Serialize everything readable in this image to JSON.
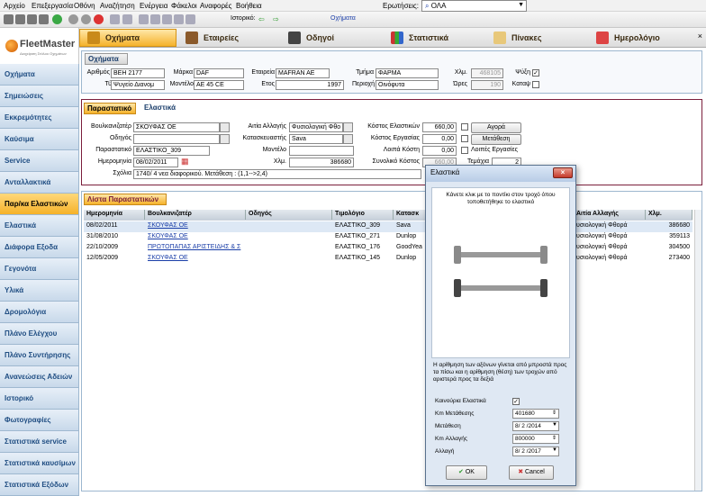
{
  "menu": [
    "Αρχείο",
    "Επεξεργασία",
    "Οθόνη",
    "Αναζήτηση",
    "Ενέργεια",
    "Φάκελοι",
    "Αναφορές",
    "Βοήθεια"
  ],
  "toolbar": {
    "history_label": "Ιστορικό:",
    "history_value": "Οχήματα",
    "query_label": "Ερωτήσεις:",
    "query_value": "ΟΛΑ"
  },
  "logo": {
    "name": "FleetMaster",
    "tagline": "Διαχείριση Στόλου Οχημάτων"
  },
  "nav": [
    {
      "label": "Οχήματα",
      "icon": "truck-icon"
    },
    {
      "label": "Εταιρείες",
      "icon": "people-icon"
    },
    {
      "label": "Οδηγοί",
      "icon": "driver-icon"
    },
    {
      "label": "Στατιστικά",
      "icon": "bar-chart-icon"
    },
    {
      "label": "Πίνακες",
      "icon": "table-icon"
    },
    {
      "label": "Ημερολόγιο",
      "icon": "calendar-icon"
    }
  ],
  "sidebar": [
    "Οχήματα",
    "Σημειώσεις",
    "Εκκρεμότητες",
    "Καύσιμα",
    "Service",
    "Ανταλλακτικά",
    "Παρ/κα Ελαστικών",
    "Ελαστικά",
    "Διάφορα Εξοδα",
    "Γεγονότα",
    "Υλικά",
    "Δρομολόγια",
    "Πλάνο Ελέγχου",
    "Πλάνο Συντήρησης",
    "Ανανεώσεις Αδειών",
    "Ιστορικό",
    "Φωτογραφίες",
    "Στατιστικά service",
    "Στατιστικά καυσίμων",
    "Στατιστικά Εξόδων"
  ],
  "vehicle": {
    "panel_title": "Οχήματα",
    "number_label": "Αριθμός",
    "number": "ΒΕΗ 2177",
    "brand_label": "Μάρκα",
    "brand": "DAF",
    "company_label": "Εταιρεία",
    "company": "MAFRAN AE",
    "dept_label": "Τμήμα",
    "dept": "ΦΑΡΜΑ",
    "km_label": "Χλμ.",
    "km": "468105",
    "freeze_label": "Ψύξη",
    "freeze": "✓",
    "type_label": "Τύπος",
    "type": "Ψυγείο Διανομ",
    "model_label": "Μοντέλο",
    "model": "AE 45 CE",
    "year_label": "Ετος",
    "year": "1997",
    "area_label": "Περιοχή",
    "area": "Οινόφυτα",
    "hours_label": "Ώρες",
    "hours": "190",
    "catal_label": "Καταψ",
    "catal": ""
  },
  "doc_tabs": [
    "Παραστατικό",
    "Ελαστικά"
  ],
  "doc": {
    "vulc_label": "Βουλκανιζατέρ",
    "vulc": "ΣΚΟΥΦΑΣ ΟΕ",
    "driver_label": "Οδηγός",
    "driver": "",
    "paper_label": "Παραστατικό",
    "paper": "ΕΛΑΣΤΙΚΟ_309",
    "date_label": "Ημερομηνία",
    "date": "08/02/2011",
    "notes_label": "Σχόλια",
    "notes": "1740/ 4 νεα διαφορικού.  Μετάθεση : (1,1-->2,4)",
    "reason_label": "Αιτία Αλλαγής",
    "reason": "Φυσιολογική Φθο",
    "maker_label": "Κατασκευαστής",
    "maker": "Sava",
    "model_label": "Μοντέλο",
    "model": "",
    "km_label": "Χλμ.",
    "km": "386680",
    "tire_cost_label": "Κόστος Ελαστικών",
    "tire_cost": "660,00",
    "work_cost_label": "Κόστος Εργασίας",
    "work_cost": "0,00",
    "other_cost_label": "Λοιπά Κόστη",
    "other_cost": "0,00",
    "total_label": "Συνολικό Κόστος",
    "total": "660,00",
    "pieces_label": "Τεμάχια",
    "pieces": "2",
    "buy_label": "Αγορά",
    "move_label": "Μετάθεση",
    "other_work_label": "Λοιπές Εργασίες"
  },
  "list": {
    "title": "Λίστα Παραστατικών",
    "headers": [
      "Ημερομηνία",
      "Βουλκανιζατέρ",
      "Οδηγός",
      "Τιμολόγιο",
      "Κατασκ",
      "",
      "Αιτία Αλλαγής",
      "Χλμ."
    ],
    "rows": [
      [
        "08/02/2011",
        "ΣΚΟΥΦΑΣ ΟΕ",
        "",
        "ΕΛΑΣΤΙΚΟ_309",
        "Sava",
        "υσιολογική Φθορά",
        "386680"
      ],
      [
        "31/08/2010",
        "ΣΚΟΥΦΑΣ ΟΕ",
        "",
        "ΕΛΑΣΤΙΚΟ_271",
        "Dunlop",
        "υσιολογική Φθορά",
        "359113"
      ],
      [
        "22/10/2009",
        "ΠΡΩΤΟΠΑΠΑΣ ΑΡΙΣΤΕΙΔΗΣ & Σ",
        "",
        "ΕΛΑΣΤΙΚΟ_176",
        "GoodYea",
        "υσιολογική Φθορά",
        "304500"
      ],
      [
        "12/05/2009",
        "ΣΚΟΥΦΑΣ ΟΕ",
        "",
        "ΕΛΑΣΤΙΚΟ_145",
        "Dunlop",
        "υσιολογική Φθορά",
        "273400"
      ]
    ]
  },
  "dialog": {
    "title": "Ελαστικά",
    "instruction": "Κάνετε κλικ με το ποντίκι στον τροχό όπου τοποθετήθηκε το ελαστικό",
    "note": "Η αρίθμηση των αξόνων γίνεται από μπροστά προς τα πίσω και η αρίθμηση (θέση) των τροχών από αριστερά προς τα δεξιά",
    "new_tire_label": "Καινούρια Ελαστικά",
    "new_tire": "✓",
    "move_km_label": "Κm Μετάθεσης",
    "move_km": "401680",
    "move_label": "Μετάθεση",
    "move_date": "8/ 2 /2014",
    "change_km_label": "Κm Αλλαγής",
    "change_km": "800000",
    "change_label": "Αλλαγή",
    "change_date": "8/ 2 /2017",
    "ok": "OK",
    "cancel": "Cancel"
  },
  "colors": {
    "accent": "#f5b22a",
    "sidebar": "#cfe0ef",
    "panel_border": "#7b1e3c"
  }
}
